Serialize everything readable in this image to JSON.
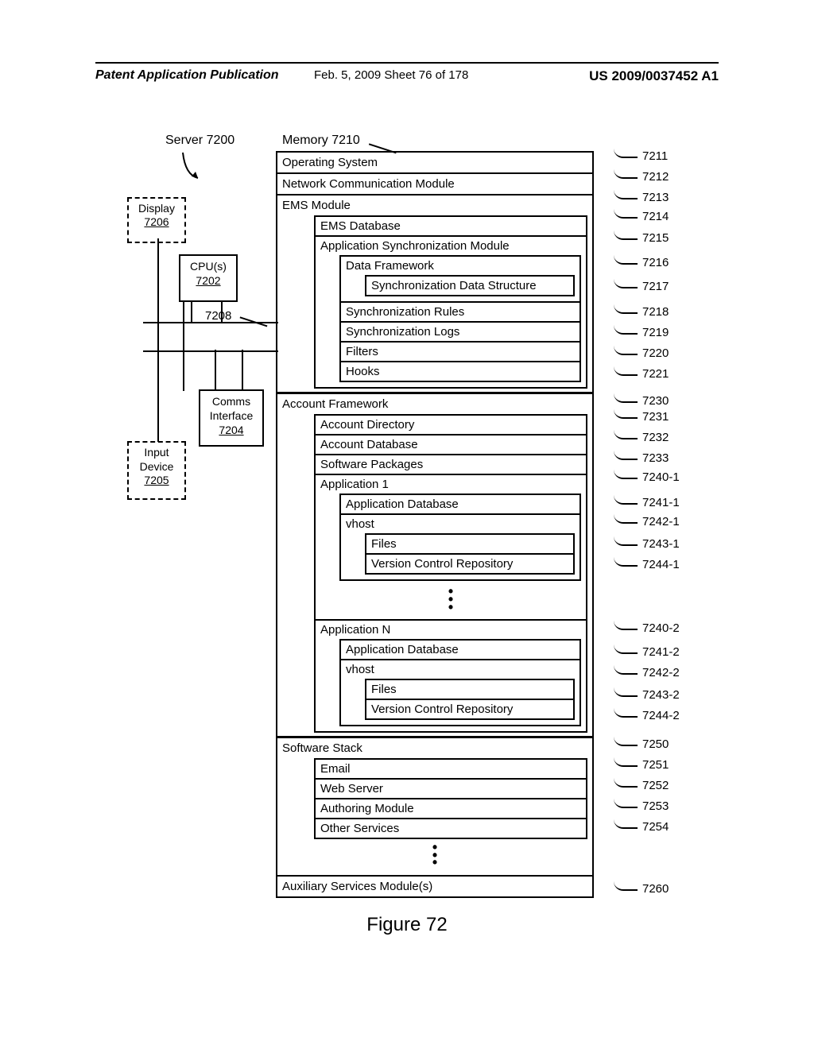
{
  "header": {
    "left": "Patent Application Publication",
    "center": "Feb. 5, 2009  Sheet 76 of 178",
    "right": "US 2009/0037452 A1"
  },
  "server_label": "Server 7200",
  "display": {
    "name": "Display",
    "num": "7206"
  },
  "cpu": {
    "name": "CPU(s)",
    "num": "7202"
  },
  "comms": {
    "l1": "Comms",
    "l2": "Interface",
    "num": "7204"
  },
  "input": {
    "l1": "Input",
    "l2": "Device",
    "num": "7205"
  },
  "bus_label": "7208",
  "mem_label": "Memory 7210",
  "figure": "Figure 72",
  "rows": {
    "os": "Operating System",
    "net": "Network Communication Module",
    "ems": "EMS Module",
    "ems_db": "EMS Database",
    "app_sync": "Application Synchronization Module",
    "data_fw": "Data Framework",
    "sync_ds": "Synchronization Data Structure",
    "sync_rules": "Synchronization Rules",
    "sync_logs": "Synchronization Logs",
    "filters": "Filters",
    "hooks": "Hooks",
    "acct_fw": "Account Framework",
    "acct_dir": "Account Directory",
    "acct_db": "Account Database",
    "sw_pkg": "Software Packages",
    "app1": "Application 1",
    "app_db": "Application Database",
    "vhost": "vhost",
    "files": "Files",
    "vcr": "Version Control Repository",
    "appn": "Application N",
    "sw_stack": "Software Stack",
    "email": "Email",
    "web": "Web Server",
    "auth": "Authoring Module",
    "other": "Other Services",
    "aux": "Auxiliary Services Module(s)"
  },
  "refs": {
    "r7211": "7211",
    "r7212": "7212",
    "r7213": "7213",
    "r7214": "7214",
    "r7215": "7215",
    "r7216": "7216",
    "r7217": "7217",
    "r7218": "7218",
    "r7219": "7219",
    "r7220": "7220",
    "r7221": "7221",
    "r7230": "7230",
    "r7231": "7231",
    "r7232": "7232",
    "r7233": "7233",
    "r7240_1": "7240-1",
    "r7241_1": "7241-1",
    "r7242_1": "7242-1",
    "r7243_1": "7243-1",
    "r7244_1": "7244-1",
    "r7240_2": "7240-2",
    "r7241_2": "7241-2",
    "r7242_2": "7242-2",
    "r7243_2": "7243-2",
    "r7244_2": "7244-2",
    "r7250": "7250",
    "r7251": "7251",
    "r7252": "7252",
    "r7253": "7253",
    "r7254": "7254",
    "r7260": "7260"
  }
}
